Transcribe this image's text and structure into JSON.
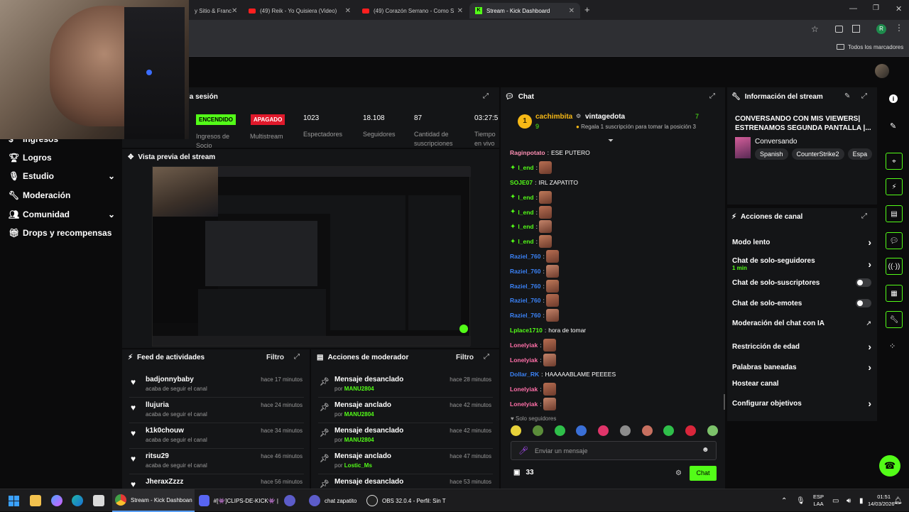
{
  "browser": {
    "tabs": [
      {
        "label": "y Sitio & Franc",
        "kind": "plain"
      },
      {
        "label": "(49) Reik - Yo Quisiera (Video)",
        "kind": "yt"
      },
      {
        "label": "(49) Corazón Serrano - Como S",
        "kind": "yt"
      },
      {
        "label": "Stream - Kick Dashboard",
        "kind": "kick"
      }
    ],
    "new_tab": "+",
    "bookmarks_label": "Todos los marcadores",
    "profile_initial": "R"
  },
  "nav": {
    "items": [
      {
        "label": "Ingresos",
        "icon": "money-icon"
      },
      {
        "label": "Logros",
        "icon": "trophy-icon"
      },
      {
        "label": "Estudio",
        "icon": "chevron-down-icon"
      },
      {
        "label": "Moderación",
        "icon": "wrench-icon"
      },
      {
        "label": "Comunidad",
        "icon": "people-icon"
      },
      {
        "label": "Drops y recompensas",
        "icon": "gift-icon"
      }
    ]
  },
  "session": {
    "title": "la sesión",
    "on_label": "ENCENDIDO",
    "off_label": "APAGADO",
    "on_caption": "Ingresos de Socio",
    "off_caption": "Multistream",
    "stats": [
      {
        "value": "1023",
        "label": "Espectadores"
      },
      {
        "value": "18.108",
        "label": "Seguidores"
      },
      {
        "value": "87",
        "label": "Cantidad de suscripciones"
      },
      {
        "value": "03:27:5",
        "label": "Tiempo en vivo"
      }
    ]
  },
  "preview": {
    "title": "Vista previa del stream"
  },
  "feed": {
    "title": "Feed de actividades",
    "filter": "Filtro",
    "items": [
      {
        "user": "badjonnybaby",
        "action": "acaba de seguir el canal",
        "time": "hace 17 minutos"
      },
      {
        "user": "llujuria",
        "action": "acaba de seguir el canal",
        "time": "hace 24 minutos"
      },
      {
        "user": "k1k0chouw",
        "action": "acaba de seguir el canal",
        "time": "hace 34 minutos"
      },
      {
        "user": "ritsu29",
        "action": "acaba de seguir el canal",
        "time": "hace 46 minutos"
      },
      {
        "user": "JheraxZzzz",
        "action": "acaba de seguir el canal",
        "time": "hace 56 minutos"
      }
    ]
  },
  "mod": {
    "title": "Acciones de moderador",
    "filter": "Filtro",
    "by": "por",
    "items": [
      {
        "action": "Mensaje desanclado",
        "user": "MANU2804",
        "time": "hace 28 minutos"
      },
      {
        "action": "Mensaje anclado",
        "user": "MANU2804",
        "time": "hace 42 minutos"
      },
      {
        "action": "Mensaje desanclado",
        "user": "MANU2804",
        "time": "hace 42 minutos"
      },
      {
        "action": "Mensaje anclado",
        "user": "Lostic_Ms",
        "time": "hace 47 minutos"
      },
      {
        "action": "Mensaje desanclado",
        "user": "",
        "time": "hace 53 minutos"
      }
    ]
  },
  "chat": {
    "title": "Chat",
    "pinned": {
      "rank": "1",
      "user": "cachimbita",
      "count": "9",
      "target": "vintagedota",
      "target_count": "7",
      "gift_text": "Regala 1 suscripción para tomar la posición 3"
    },
    "messages": [
      {
        "user": "Raginpotato",
        "color": "#ff8fb4",
        "text": "ESE PUTERO",
        "emote": false
      },
      {
        "user": "l_end",
        "color": "#53fc18",
        "text": "",
        "emote": true
      },
      {
        "user": "SOJE07",
        "color": "#53fc18",
        "text": "IRL ZAPATITO",
        "emote": false
      },
      {
        "user": "l_end",
        "color": "#53fc18",
        "text": "",
        "emote": true
      },
      {
        "user": "l_end",
        "color": "#53fc18",
        "text": "",
        "emote": true
      },
      {
        "user": "l_end",
        "color": "#53fc18",
        "text": "",
        "emote": true
      },
      {
        "user": "l_end",
        "color": "#53fc18",
        "text": "",
        "emote": true
      },
      {
        "user": "Raziel_760",
        "color": "#3b82f6",
        "text": "",
        "emote": true
      },
      {
        "user": "Raziel_760",
        "color": "#3b82f6",
        "text": "",
        "emote": true
      },
      {
        "user": "Raziel_760",
        "color": "#3b82f6",
        "text": "",
        "emote": true
      },
      {
        "user": "Raziel_760",
        "color": "#3b82f6",
        "text": "",
        "emote": true
      },
      {
        "user": "Raziel_760",
        "color": "#3b82f6",
        "text": "",
        "emote": true
      },
      {
        "user": "Lplace1710",
        "color": "#53fc18",
        "text": "hora de tomar",
        "emote": false
      },
      {
        "user": "Lonelyiak",
        "color": "#ff6fa8",
        "text": "",
        "emote": true
      },
      {
        "user": "Lonelyiak",
        "color": "#ff6fa8",
        "text": "",
        "emote": true
      },
      {
        "user": "Dollar_RK",
        "color": "#3b82f6",
        "text": "HAAAAABLAME PEEEES",
        "emote": false
      },
      {
        "user": "Lonelyiak",
        "color": "#ff6fa8",
        "text": "",
        "emote": true
      },
      {
        "user": "Lonelyiak",
        "color": "#ff6fa8",
        "text": "",
        "emote": true
      }
    ],
    "followers_only": "Solo seguidores",
    "input_placeholder": "Enviar un mensaje",
    "points": "33",
    "send_label": "Chat"
  },
  "info": {
    "title": "Información del stream",
    "stream_title": "CONVERSANDO CON MIS VIEWERS| ESTRENAMOS SEGUNDA PANTALLA |...",
    "category": "Conversando",
    "tags": [
      "Spanish",
      "CounterStrike2",
      "Espa"
    ]
  },
  "actions": {
    "title": "Acciones de canal",
    "items": [
      {
        "label": "Modo lento",
        "control": "chevron",
        "sub": ""
      },
      {
        "label": "Chat de solo-seguidores",
        "control": "chevron",
        "sub": "1 min"
      },
      {
        "label": "Chat de solo-suscriptores",
        "control": "toggle",
        "sub": ""
      },
      {
        "label": "Chat de solo-emotes",
        "control": "toggle",
        "sub": ""
      },
      {
        "label": "Moderación del chat con IA",
        "control": "external",
        "sub": ""
      },
      {
        "label": "Restricción de edad",
        "control": "chevron",
        "sub": ""
      },
      {
        "label": "Palabras baneadas",
        "control": "chevron",
        "sub": ""
      },
      {
        "label": "Hostear canal",
        "control": "none",
        "sub": ""
      },
      {
        "label": "Configurar objetivos",
        "control": "chevron",
        "sub": ""
      }
    ]
  },
  "taskbar": {
    "apps": [
      {
        "label": "Stream - Kick Dashboan"
      },
      {
        "label": "#[👾]CLIPS-DE-KICK👾 |"
      },
      {
        "label": "chat zapatito"
      },
      {
        "label": "OBS 32.0.4 - Perfil: Sin T"
      }
    ],
    "lang": "ESP",
    "lang2": "LAA",
    "time": "01:51",
    "date": "14/03/2026"
  },
  "colors": {
    "kick_green": "#53fc18",
    "off_red": "#e0192b",
    "panel": "#141517"
  }
}
